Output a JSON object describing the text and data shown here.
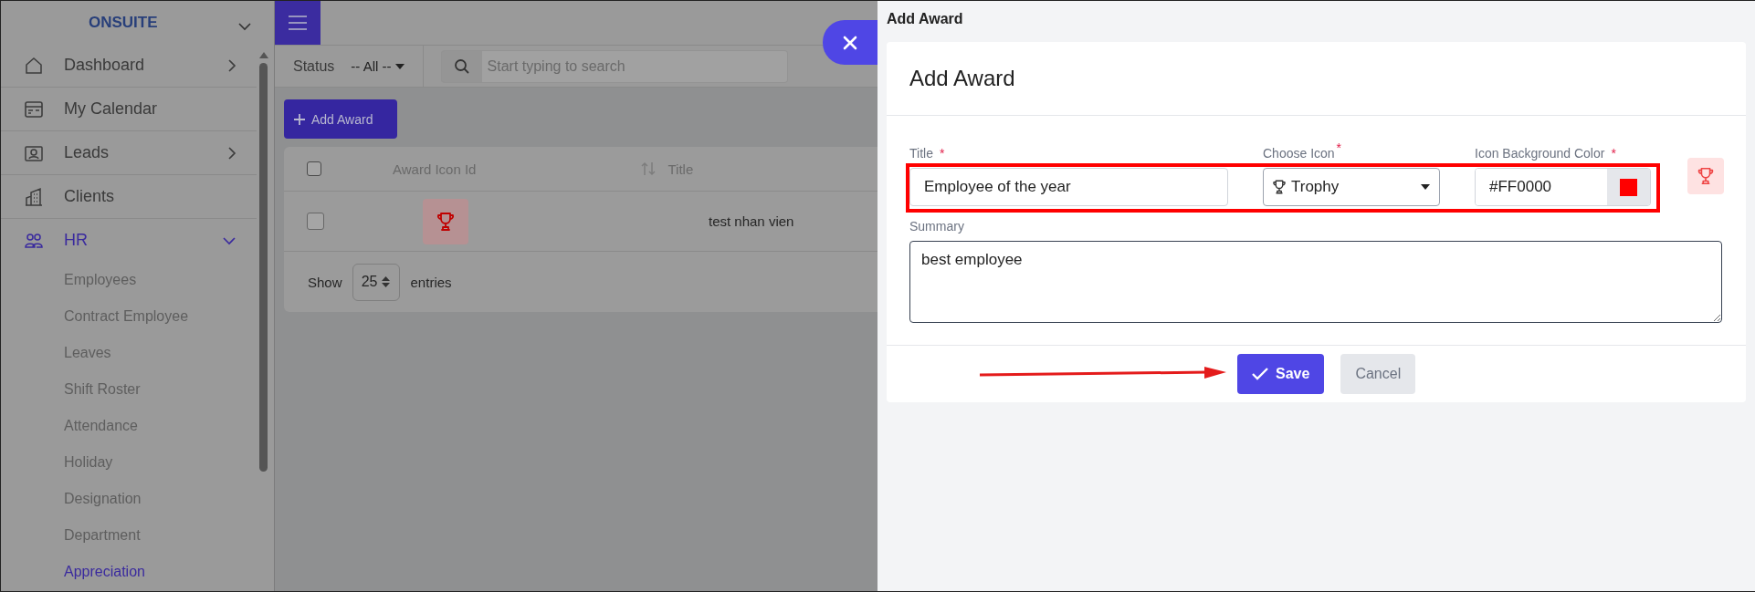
{
  "sidebar": {
    "brand": "ONSUITE",
    "items": [
      {
        "label": "Dashboard",
        "kind": "group",
        "expanded": false,
        "selected": false
      },
      {
        "label": "My Calendar",
        "kind": "link",
        "selected": false
      },
      {
        "label": "Leads",
        "kind": "group",
        "expanded": false,
        "selected": false
      },
      {
        "label": "Clients",
        "kind": "link",
        "selected": false
      },
      {
        "label": "HR",
        "kind": "group",
        "expanded": true,
        "selected": true,
        "children": [
          {
            "label": "Employees",
            "selected": false
          },
          {
            "label": "Contract Employee",
            "selected": false
          },
          {
            "label": "Leaves",
            "selected": false
          },
          {
            "label": "Shift Roster",
            "selected": false
          },
          {
            "label": "Attendance",
            "selected": false
          },
          {
            "label": "Holiday",
            "selected": false
          },
          {
            "label": "Designation",
            "selected": false
          },
          {
            "label": "Department",
            "selected": false
          },
          {
            "label": "Appreciation",
            "selected": true
          }
        ]
      }
    ]
  },
  "toolbar": {
    "status_label": "Status",
    "status_value": "-- All --",
    "search": {
      "placeholder": "Start typing to search"
    }
  },
  "add_button": "Add Award",
  "table": {
    "header_checked": false,
    "columns": [
      "Award Icon Id",
      "Title"
    ],
    "rows": [
      {
        "checked": false,
        "title": "test nhan vien"
      }
    ],
    "footer": {
      "show": "Show",
      "page_size": "25",
      "entries": "entries"
    }
  },
  "panel": {
    "header": "Add Award",
    "title": "Add Award",
    "fields": [
      {
        "kind": "text",
        "label": "Title",
        "required_mark": "*",
        "value": "Employee of the year"
      },
      {
        "kind": "select",
        "label": "Choose Icon",
        "required_mark": "*",
        "value": "Trophy"
      },
      {
        "kind": "color",
        "label": "Icon Background Color",
        "required_mark": "*",
        "value": "#FF0000",
        "color": "#ff0000"
      }
    ],
    "summary": {
      "label": "Summary",
      "value": "best employee"
    },
    "buttons": [
      {
        "label": "Save",
        "kind": "primary"
      },
      {
        "label": "Cancel",
        "kind": "secondary"
      }
    ]
  }
}
